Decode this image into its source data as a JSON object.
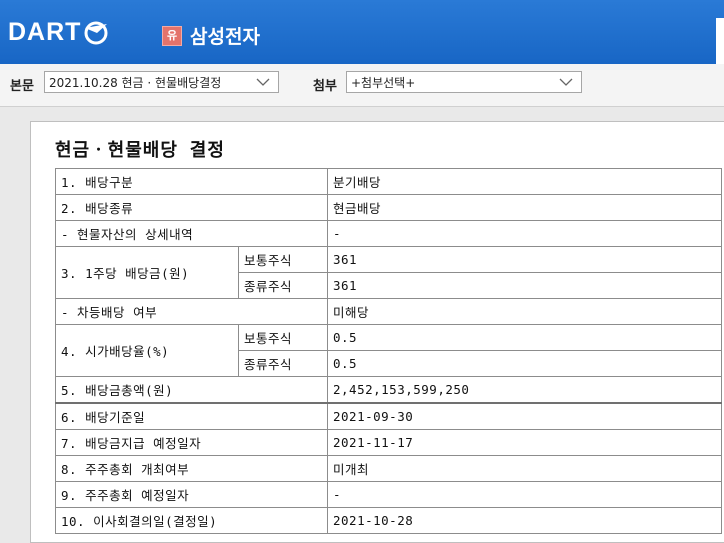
{
  "header": {
    "logo_text": "DART",
    "corp_badge": "유",
    "corp_name": "삼성전자"
  },
  "toolbar": {
    "main_label": "본문",
    "main_select": "2021.10.28  현금 · 현물배당결정",
    "attach_label": "첨부",
    "attach_select": "+첨부선택+"
  },
  "document": {
    "title": "현금ㆍ현물배당 결정",
    "rows": [
      {
        "label": "1. 배당구분",
        "value": "분기배당"
      },
      {
        "label": "2. 배당종류",
        "value": "현금배당"
      },
      {
        "label": "- 현물자산의 상세내역",
        "value": "-"
      },
      {
        "label": "3. 1주당 배당금(원)",
        "sub": [
          {
            "label": "보통주식",
            "value": "361"
          },
          {
            "label": "종류주식",
            "value": "361"
          }
        ]
      },
      {
        "label": "- 차등배당 여부",
        "value": "미해당"
      },
      {
        "label": "4. 시가배당율(%)",
        "sub": [
          {
            "label": "보통주식",
            "value": "0.5"
          },
          {
            "label": "종류주식",
            "value": "0.5"
          }
        ]
      },
      {
        "label": "5. 배당금총액(원)",
        "value": "2,452,153,599,250"
      },
      {
        "label": "6. 배당기준일",
        "value": "2021-09-30"
      },
      {
        "label": "7. 배당금지급 예정일자",
        "value": "2021-11-17"
      },
      {
        "label": "8. 주주총회 개최여부",
        "value": "미개최"
      },
      {
        "label": "9. 주주총회 예정일자",
        "value": "-"
      },
      {
        "label": "10. 이사회결의일(결정일)",
        "value": "2021-10-28"
      }
    ]
  }
}
